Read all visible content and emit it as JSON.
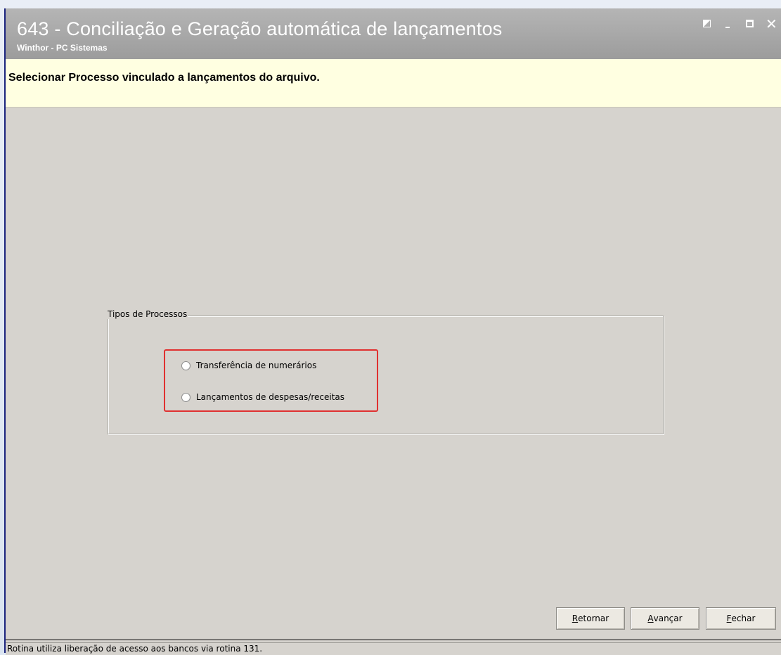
{
  "window": {
    "title": "643 - Conciliação e Geração automática de lançamentos",
    "subtitle": "Winthor - PC Sistemas",
    "controls": {
      "restore_icon": "restore-icon",
      "minimize_icon": "minimize-icon",
      "maximize_icon": "maximize-icon",
      "close_label": "✕"
    }
  },
  "header": {
    "instruction": "Selecionar Processo vinculado a lançamentos do arquivo."
  },
  "process_group": {
    "legend": "Tipos de Processos",
    "options": [
      {
        "label": "Transferência de numerários",
        "selected": false
      },
      {
        "label": "Lançamentos de despesas/receitas",
        "selected": false
      }
    ],
    "highlight_color": "#e03030"
  },
  "buttons": {
    "back": {
      "mnemonic": "R",
      "rest": "etornar"
    },
    "next": {
      "mnemonic": "A",
      "rest": "vançar"
    },
    "close": {
      "mnemonic": "F",
      "rest": "echar"
    }
  },
  "status": {
    "text": "Rotina utiliza liberação de acesso aos bancos via rotina 131."
  },
  "colors": {
    "titlebar": "#a8a8a8",
    "window_border": "#1a237e",
    "header_band": "#ffffe1",
    "client": "#d6d3ce"
  }
}
